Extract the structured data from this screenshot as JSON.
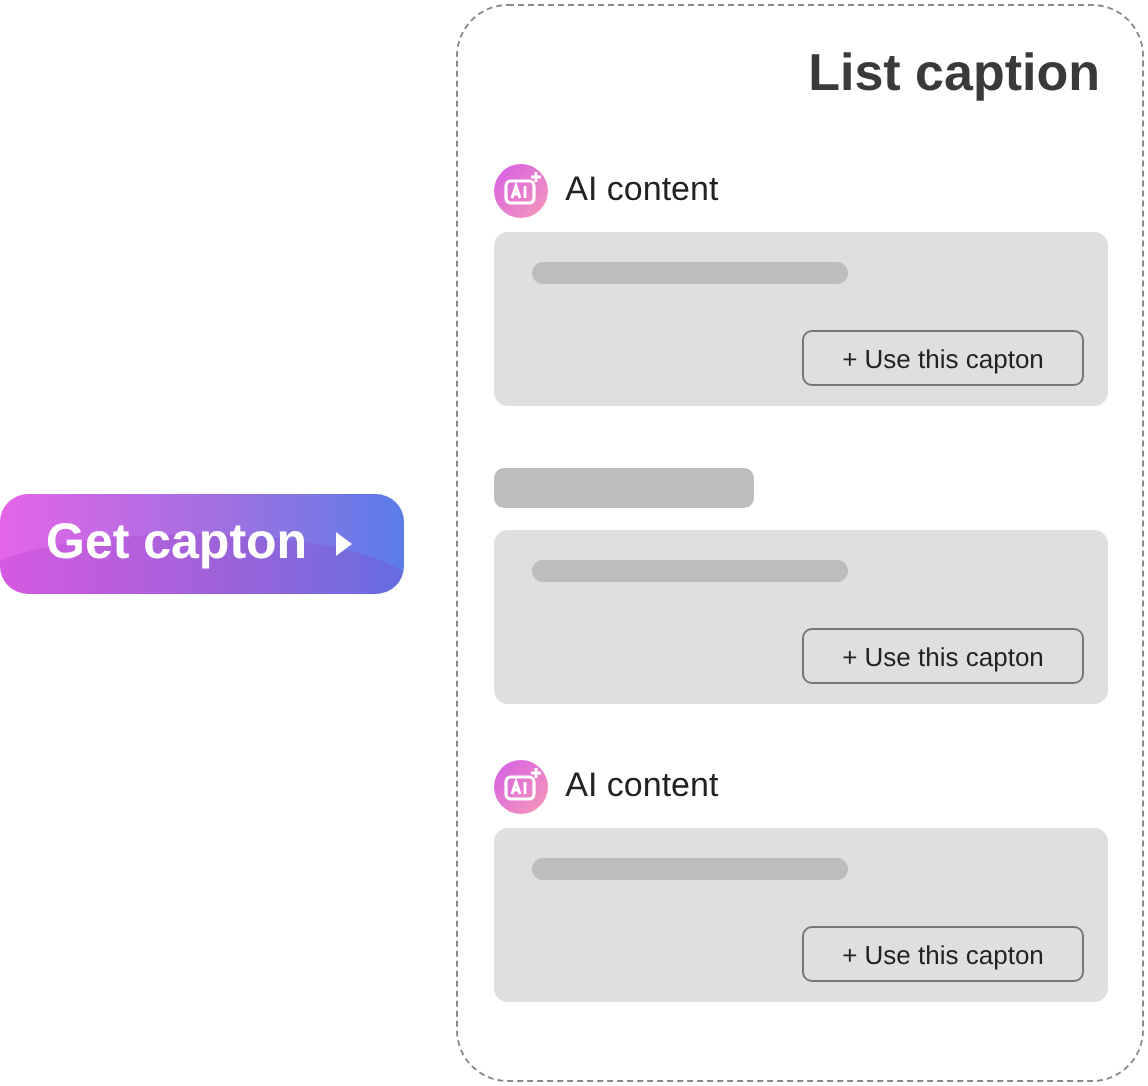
{
  "action_button": {
    "label": "Get capton"
  },
  "panel": {
    "title": "List caption"
  },
  "items": [
    {
      "kind": "ai",
      "label": "AI content",
      "button": "+ Use this capton"
    },
    {
      "kind": "loading",
      "button": "+ Use this capton"
    },
    {
      "kind": "ai",
      "label": "AI content",
      "button": "+ Use this capton"
    }
  ]
}
